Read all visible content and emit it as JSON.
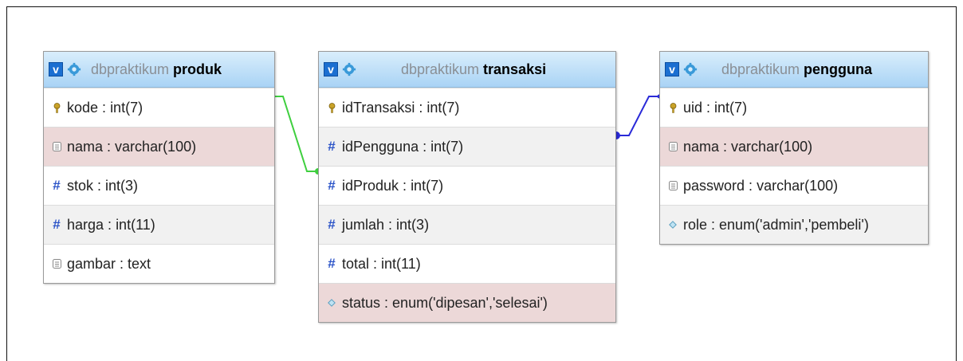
{
  "toggle_label": "v",
  "tables": [
    {
      "id": "produk",
      "db": "dbpraktikum",
      "name": "produk",
      "columns": [
        {
          "name": "kode",
          "type": "int(7)",
          "icon": "key-icon",
          "highlight": false
        },
        {
          "name": "nama",
          "type": "varchar(100)",
          "icon": "text-field-icon",
          "highlight": true
        },
        {
          "name": "stok",
          "type": "int(3)",
          "icon": "number-icon",
          "highlight": false
        },
        {
          "name": "harga",
          "type": "int(11)",
          "icon": "number-icon",
          "highlight": false
        },
        {
          "name": "gambar",
          "type": "text",
          "icon": "text-field-icon",
          "highlight": false
        }
      ]
    },
    {
      "id": "transaksi",
      "db": "dbpraktikum",
      "name": "transaksi",
      "columns": [
        {
          "name": "idTransaksi",
          "type": "int(7)",
          "icon": "key-icon",
          "highlight": false
        },
        {
          "name": "idPengguna",
          "type": "int(7)",
          "icon": "number-icon",
          "highlight": false
        },
        {
          "name": "idProduk",
          "type": "int(7)",
          "icon": "number-icon",
          "highlight": false
        },
        {
          "name": "jumlah",
          "type": "int(3)",
          "icon": "number-icon",
          "highlight": false
        },
        {
          "name": "total",
          "type": "int(11)",
          "icon": "number-icon",
          "highlight": false
        },
        {
          "name": "status",
          "type": "enum('dipesan','selesai')",
          "icon": "enum-icon",
          "highlight": true
        }
      ]
    },
    {
      "id": "pengguna",
      "db": "dbpraktikum",
      "name": "pengguna",
      "columns": [
        {
          "name": "uid",
          "type": "int(7)",
          "icon": "key-icon",
          "highlight": false
        },
        {
          "name": "nama",
          "type": "varchar(100)",
          "icon": "text-field-icon",
          "highlight": true
        },
        {
          "name": "password",
          "type": "varchar(100)",
          "icon": "text-field-icon",
          "highlight": false
        },
        {
          "name": "role",
          "type": "enum('admin','pembeli')",
          "icon": "enum-icon",
          "highlight": false
        }
      ]
    }
  ],
  "relations": [
    {
      "from": "produk.kode",
      "to": "transaksi.idProduk",
      "color": "#3fcf3f"
    },
    {
      "from": "pengguna.uid",
      "to": "transaksi.idPengguna",
      "color": "#2a2ad8"
    }
  ],
  "colors": {
    "header_top": "#d9eefc",
    "header_bottom": "#a9d3f5",
    "toggle_blue": "#1b6fd1",
    "row_highlight": "#ecd8d8",
    "row_alt": "#f1f1f1",
    "key_gold": "#c9a227",
    "hash_blue": "#2d55c8"
  }
}
